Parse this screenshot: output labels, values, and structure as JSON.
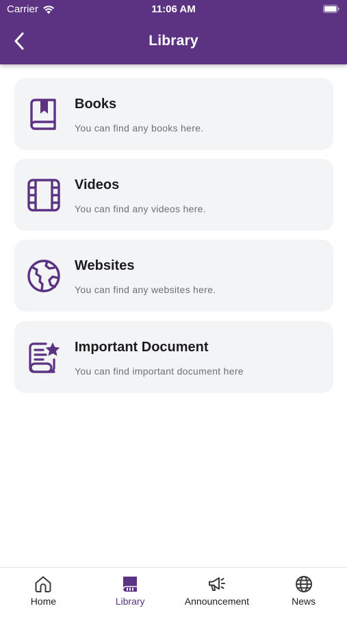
{
  "colors": {
    "primary": "#5c3382",
    "card_background": "#f3f4f6",
    "subtitle_text": "#6f6f73"
  },
  "status_bar": {
    "carrier": "Carrier",
    "time": "11:06 AM"
  },
  "nav": {
    "title": "Library",
    "back_icon": "chevron-left-icon"
  },
  "cards": [
    {
      "title": "Books",
      "subtitle": "You can find any books here.",
      "icon": "book-icon"
    },
    {
      "title": "Videos",
      "subtitle": "You can find any videos here.",
      "icon": "film-icon"
    },
    {
      "title": "Websites",
      "subtitle": "You can find any websites here.",
      "icon": "globe-icon"
    },
    {
      "title": "Important Document",
      "subtitle": "You can find important document here",
      "icon": "document-star-icon"
    }
  ],
  "tabs": [
    {
      "label": "Home",
      "icon": "home-icon",
      "active": false
    },
    {
      "label": "Library",
      "icon": "library-book-icon",
      "active": true
    },
    {
      "label": "Announcement",
      "icon": "megaphone-icon",
      "active": false
    },
    {
      "label": "News",
      "icon": "globe-icon",
      "active": false
    }
  ]
}
